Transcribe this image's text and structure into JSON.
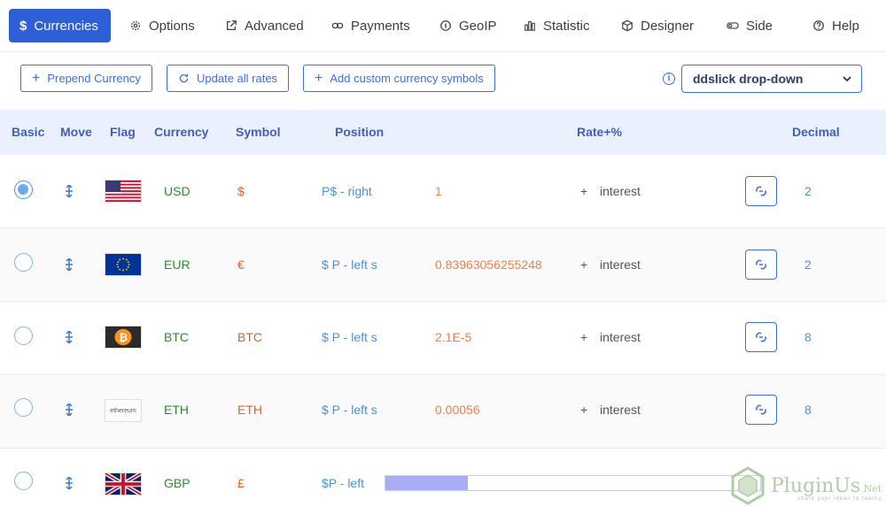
{
  "tabs": [
    {
      "label": "Currencies",
      "icon": "dollar-icon",
      "active": true
    },
    {
      "label": "Options",
      "icon": "gear-icon"
    },
    {
      "label": "Advanced",
      "icon": "external-link-icon"
    },
    {
      "label": "Payments",
      "icon": "infinity-icon"
    },
    {
      "label": "GeoIP",
      "icon": "info-circle-icon"
    },
    {
      "label": "Statistic",
      "icon": "bar-chart-icon"
    },
    {
      "label": "Designer",
      "icon": "cube-icon"
    },
    {
      "label": "Side",
      "icon": "toggle-icon"
    },
    {
      "label": "Help",
      "icon": "question-circle-icon"
    }
  ],
  "toolbar": {
    "prepend_label": "Prepend Currency",
    "update_label": "Update all rates",
    "custom_symbols_label": "Add custom currency symbols",
    "switcher_value": "ddslick drop-down"
  },
  "table": {
    "headers": {
      "basic": "Basic",
      "move": "Move",
      "flag": "Flag",
      "currency": "Currency",
      "symbol": "Symbol",
      "position": "Position",
      "rate": "Rate+%",
      "decimal": "Decimal"
    },
    "rows": [
      {
        "code": "USD",
        "symbol": "$",
        "position": "P$ - right",
        "rate": "1",
        "plus": "+",
        "interest": "interest",
        "decimal": "2",
        "basic": true,
        "flag": "usa"
      },
      {
        "code": "EUR",
        "symbol": "€",
        "position": "$ P - left s",
        "rate": "0.83963056255248",
        "plus": "+",
        "interest": "interest",
        "decimal": "2",
        "basic": false,
        "flag": "eu"
      },
      {
        "code": "BTC",
        "symbol": "BTC",
        "position": "$ P - left s",
        "rate": "2.1E-5",
        "plus": "+",
        "interest": "interest",
        "decimal": "8",
        "basic": false,
        "flag": "bitcoin"
      },
      {
        "code": "ETH",
        "symbol": "ETH",
        "position": "$ P - left s",
        "rate": "0.00056",
        "plus": "+",
        "interest": "interest",
        "decimal": "8",
        "basic": false,
        "flag": "ethereum",
        "flag_text": "ethereum"
      },
      {
        "code": "GBP",
        "symbol": "£",
        "position": "$P - left",
        "basic": false,
        "flag": "uk"
      }
    ]
  },
  "loading_progress": 0.22,
  "watermark": {
    "brand": "PluginUs",
    "suffix": ".Net",
    "tagline": "share your ideas to reality"
  },
  "colors": {
    "accent": "#2e5fd6",
    "code": "#2f8a2f",
    "symbol": "#e15c2a",
    "rate": "#ef7f4b",
    "position": "#4f8fd4"
  }
}
